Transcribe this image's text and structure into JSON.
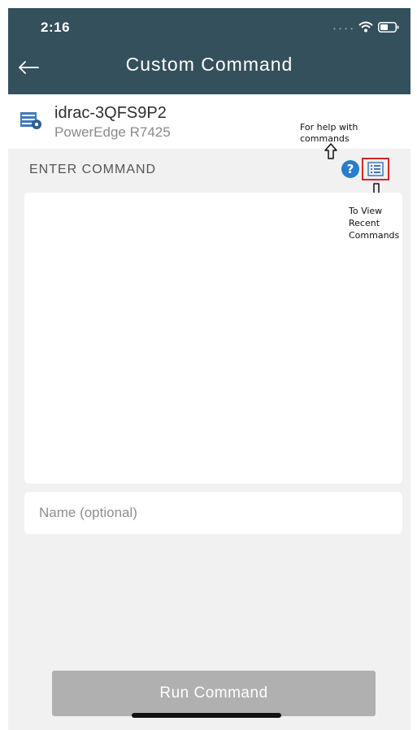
{
  "status_bar": {
    "time": "2:16"
  },
  "header": {
    "title": "Custom Command"
  },
  "device": {
    "name": "idrac-3QFS9P2",
    "model": "PowerEdge R7425"
  },
  "annotations": {
    "help_line1": "For help with",
    "help_line2": "commands",
    "recent_line1": "To View",
    "recent_line2": "Recent",
    "recent_line3": "Commands"
  },
  "command": {
    "section_label": "ENTER COMMAND"
  },
  "name_field": {
    "placeholder": "Name (optional)",
    "value": ""
  },
  "actions": {
    "run_label": "Run Command"
  },
  "colors": {
    "header_bg": "#34505c",
    "help_icon": "#2a7ccc",
    "highlight_border": "#d62828",
    "button_disabled": "#b0b0b0"
  },
  "icons": [
    "back-arrow-icon",
    "wifi-icon",
    "battery-icon",
    "server-settings-icon",
    "help-icon",
    "recent-list-icon",
    "arrow-up-icon",
    "arrow-down-icon"
  ]
}
